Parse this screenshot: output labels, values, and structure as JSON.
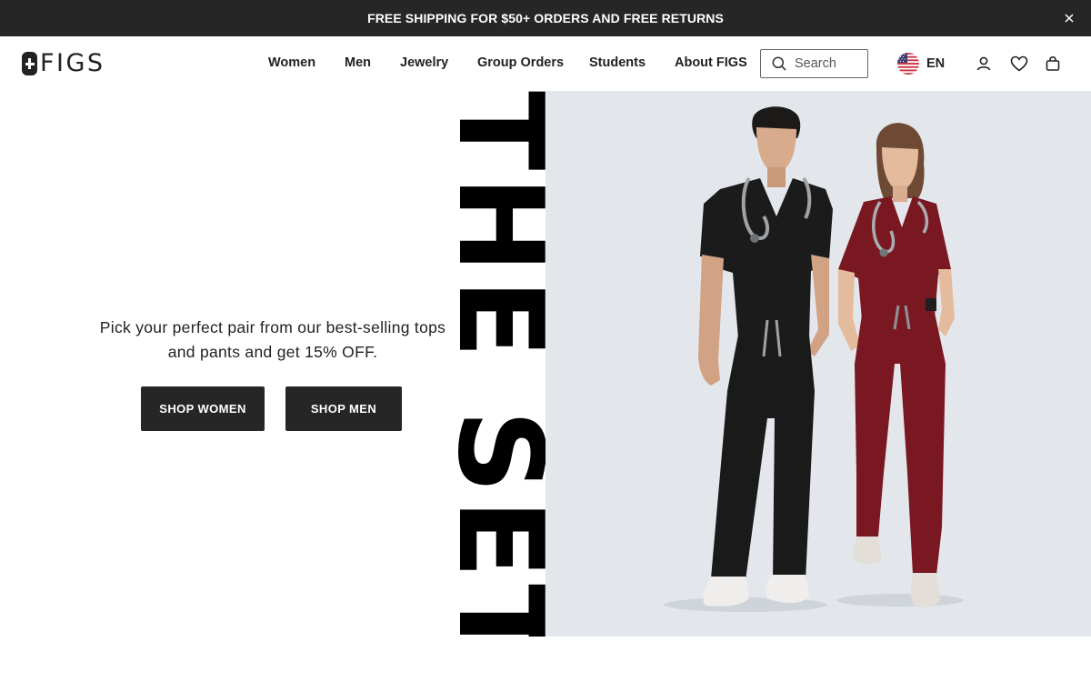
{
  "promo": {
    "text": "FREE SHIPPING FOR $50+ ORDERS AND FREE RETURNS",
    "close_icon": "close-icon"
  },
  "header": {
    "logo": "FIGS",
    "nav": [
      {
        "label": "Women"
      },
      {
        "label": "Men"
      },
      {
        "label": "Jewelry"
      },
      {
        "label": "Group Orders"
      },
      {
        "label": "Students"
      },
      {
        "label": "About FIGS"
      }
    ],
    "search": {
      "placeholder": "Search",
      "icon": "search-icon"
    },
    "language": {
      "label": "EN",
      "flag": "us-flag-icon"
    },
    "icons": [
      "account-icon",
      "wishlist-heart-icon",
      "shopping-bag-icon"
    ]
  },
  "hero": {
    "copy": "Pick your perfect pair from our best-selling tops and pants and get 15% OFF.",
    "title": "THE SET",
    "buttons": {
      "women": "SHOP WOMEN",
      "men": "SHOP MEN"
    },
    "image": "scrubs-models-photo"
  },
  "colors": {
    "dark": "#262626",
    "photo_bg": "#e3e7ec",
    "burgundy": "#7a1822"
  }
}
